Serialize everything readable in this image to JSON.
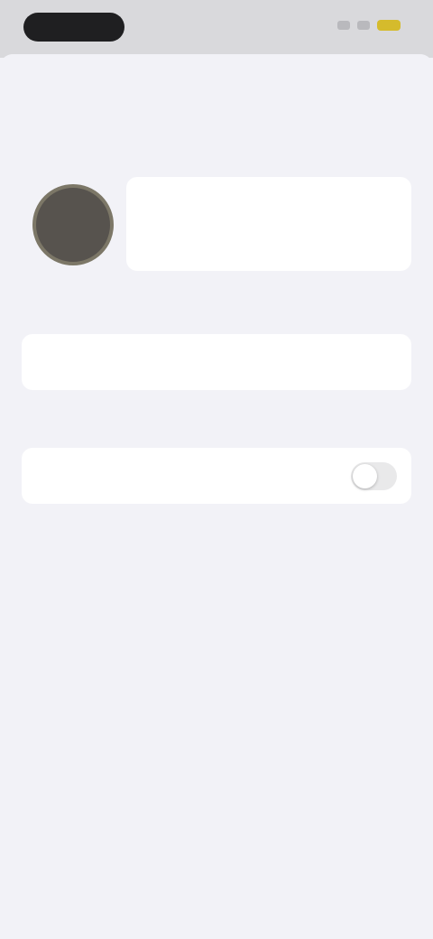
{
  "status_bar": {
    "colors": {
      "pill": "#1f1f21",
      "battery": "#d5bb2c"
    }
  },
  "nav": {
    "cancel_label": "",
    "title": "",
    "done_label": ""
  },
  "profile_section": {
    "header": "",
    "avatar_initials": "",
    "name_placeholder": "",
    "name_value": ""
  },
  "section_one": {
    "header": "",
    "row_label": "",
    "row_value": ""
  },
  "section_two": {
    "header": "",
    "row_label": "",
    "toggle_on": false,
    "footnote": ""
  },
  "colors": {
    "accent": "#d5bb2c",
    "background": "#f2f2f7",
    "card": "#ffffff",
    "avatar": "#57534e"
  }
}
